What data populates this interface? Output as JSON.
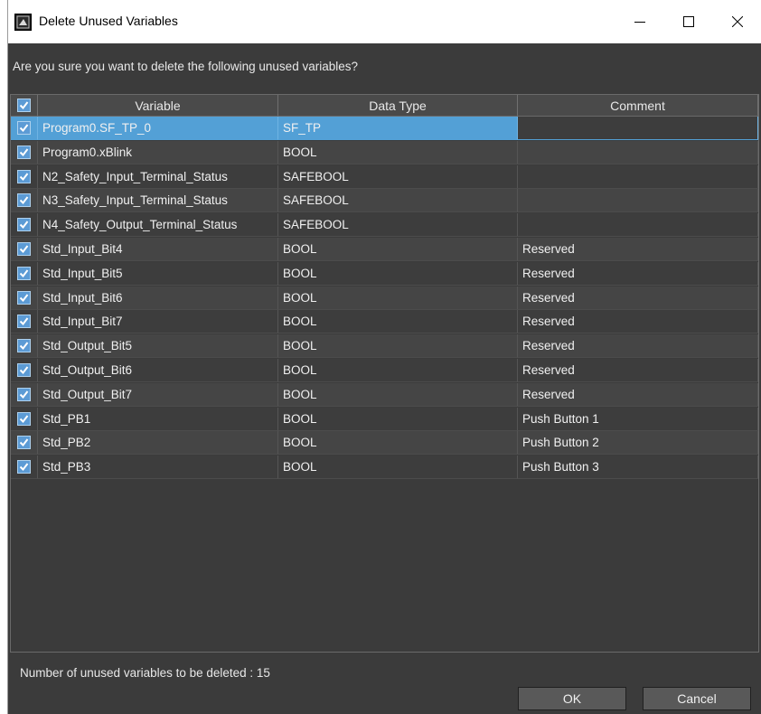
{
  "window": {
    "title": "Delete Unused Variables",
    "icons": {
      "app": "app-icon",
      "minimize": "minimize-icon",
      "maximize": "maximize-icon",
      "close": "close-icon"
    }
  },
  "prompt": "Are you sure you want to delete the following unused variables?",
  "table": {
    "columns": [
      "Variable",
      "Data Type",
      "Comment"
    ],
    "header_checkbox_checked": true,
    "selected_row_index": 0,
    "rows": [
      {
        "variable": "Program0.SF_TP_0",
        "type": "SF_TP",
        "comment": "",
        "checked": true
      },
      {
        "variable": "Program0.xBlink",
        "type": "BOOL",
        "comment": "",
        "checked": true
      },
      {
        "variable": "N2_Safety_Input_Terminal_Status",
        "type": "SAFEBOOL",
        "comment": "",
        "checked": true
      },
      {
        "variable": "N3_Safety_Input_Terminal_Status",
        "type": "SAFEBOOL",
        "comment": "",
        "checked": true
      },
      {
        "variable": "N4_Safety_Output_Terminal_Status",
        "type": "SAFEBOOL",
        "comment": "",
        "checked": true
      },
      {
        "variable": "Std_Input_Bit4",
        "type": "BOOL",
        "comment": "Reserved",
        "checked": true
      },
      {
        "variable": "Std_Input_Bit5",
        "type": "BOOL",
        "comment": "Reserved",
        "checked": true
      },
      {
        "variable": "Std_Input_Bit6",
        "type": "BOOL",
        "comment": "Reserved",
        "checked": true
      },
      {
        "variable": "Std_Input_Bit7",
        "type": "BOOL",
        "comment": "Reserved",
        "checked": true
      },
      {
        "variable": "Std_Output_Bit5",
        "type": "BOOL",
        "comment": "Reserved",
        "checked": true
      },
      {
        "variable": "Std_Output_Bit6",
        "type": "BOOL",
        "comment": "Reserved",
        "checked": true
      },
      {
        "variable": "Std_Output_Bit7",
        "type": "BOOL",
        "comment": "Reserved",
        "checked": true
      },
      {
        "variable": "Std_PB1",
        "type": "BOOL",
        "comment": "Push Button 1",
        "checked": true
      },
      {
        "variable": "Std_PB2",
        "type": "BOOL",
        "comment": "Push Button 2",
        "checked": true
      },
      {
        "variable": "Std_PB3",
        "type": "BOOL",
        "comment": "Push Button 3",
        "checked": true
      }
    ]
  },
  "footer": {
    "count_text": "Number of unused variables to be deleted : 15",
    "ok_label": "OK",
    "cancel_label": "Cancel"
  },
  "colors": {
    "background": "#3b3b3b",
    "selected_row": "#53a0d6",
    "checkbox": "#5c9bd5"
  }
}
